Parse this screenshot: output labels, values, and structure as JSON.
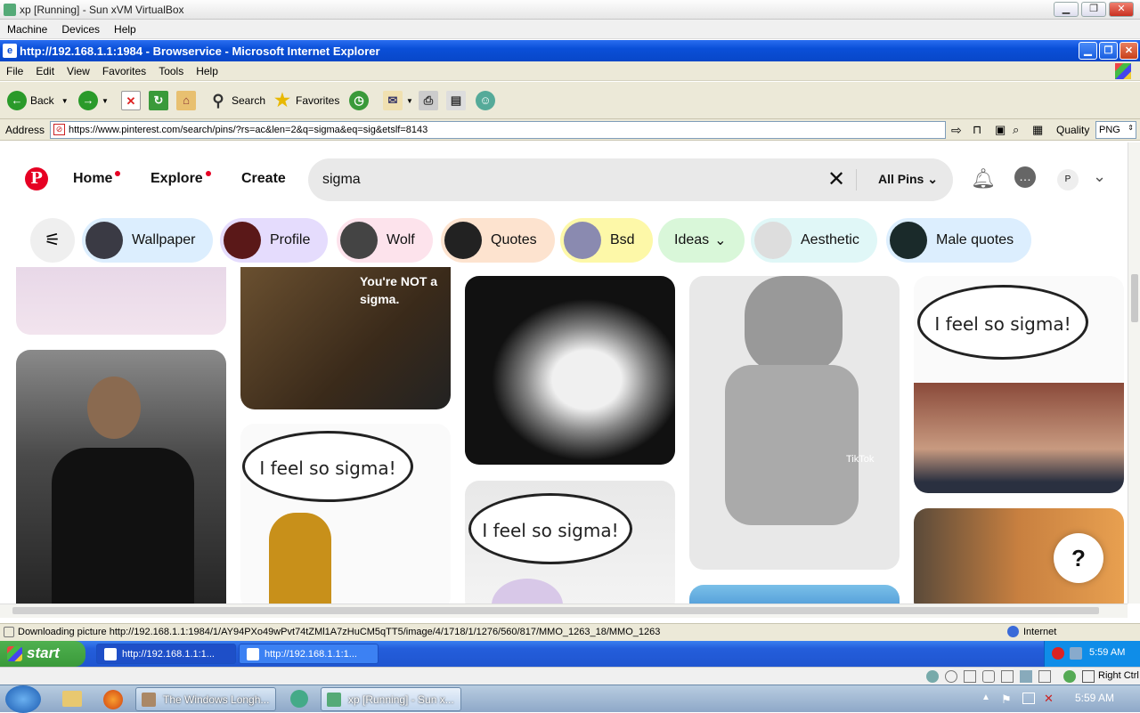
{
  "vbox": {
    "title": "xp [Running] - Sun xVM VirtualBox",
    "menu": [
      "Machine",
      "Devices",
      "Help"
    ],
    "status_right": "Right Ctrl"
  },
  "ie": {
    "title": "http://192.168.1.1:1984 - Browservice - Microsoft Internet Explorer",
    "menu": [
      "File",
      "Edit",
      "View",
      "Favorites",
      "Tools",
      "Help"
    ],
    "toolbar": {
      "back": "Back",
      "search": "Search",
      "favorites": "Favorites"
    },
    "address_label": "Address",
    "address_value": "https://www.pinterest.com/search/pins/?rs=ac&len=2&q=sigma&eq=sig&etslf=8143",
    "quality_label": "Quality",
    "quality_value": "PNG",
    "status_text": "Downloading picture http://192.168.1.1:1984/1/AY94PXo49wPvt74tZMl1A7zHuCM5qTT5/image/4/1718/1/1276/560/817/MMO_1263_18/MMO_1263",
    "status_zone": "Internet"
  },
  "pinterest": {
    "logo": "P",
    "nav": {
      "home": "Home",
      "explore": "Explore",
      "create": "Create"
    },
    "search_value": "sigma",
    "filter": "All Pins",
    "avatar_letter": "P",
    "chips": [
      "Wallpaper",
      "Profile",
      "Wolf",
      "Quotes",
      "Bsd",
      "Ideas",
      "Aesthetic",
      "Male quotes"
    ],
    "pin_text": {
      "tiger": "You're NOT a sigma.",
      "bubble": "I feel so sigma!",
      "tiktok": "TikTok"
    },
    "help": "?",
    "colors": {
      "brand": "#e60023"
    }
  },
  "xp_taskbar": {
    "start": "start",
    "tasks": [
      "http://192.168.1.1:1...",
      "http://192.168.1.1:1..."
    ],
    "clock": "5:59 AM"
  },
  "host_taskbar": {
    "tasks": [
      "The Windows Longh...",
      "xp [Running] - Sun x..."
    ],
    "clock": "5:59 AM"
  }
}
